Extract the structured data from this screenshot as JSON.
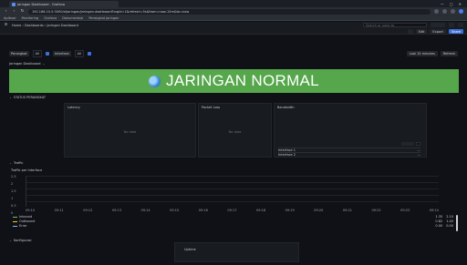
{
  "browser": {
    "tab_title": "Jaringan Dashboard - Grafana",
    "address": "192.168.10.5:3000/d/jaringan/jaringan-dashboard?orgId=1&refresh=5s&from=now-15m&to=now",
    "bookmarks": [
      "Aplikasi",
      "Monitoring",
      "Grafana",
      "Dokumentasi",
      "Perangkat Jaringan"
    ],
    "window_controls": [
      "—",
      "▢",
      "✕"
    ]
  },
  "grafana": {
    "breadcrumb": "Home › Dashboards › Jaringan Dashboard",
    "search_placeholder": "Search or jump to",
    "buttons": [
      "Edit",
      "Export",
      "Share"
    ]
  },
  "variables": [
    {
      "label": "Perangkat",
      "value": "All"
    },
    {
      "label": "Interface",
      "value": "All"
    }
  ],
  "var_right": [
    "Last 15 minutes",
    "Refresh"
  ],
  "section_dashboard": "Jaringan Dashboard",
  "banner": {
    "text": "JARINGAN NORMAL"
  },
  "row1": {
    "title": "STATUS PERANGKAT"
  },
  "panels": [
    {
      "title": "Latency",
      "nodata": "No data"
    },
    {
      "title": "Packet Loss",
      "nodata": "No data"
    },
    {
      "title": "Bandwidth"
    }
  ],
  "table": {
    "rows": [
      {
        "name": "Interface 1",
        "value": "—"
      },
      {
        "name": "Interface 2",
        "value": "—"
      }
    ]
  },
  "row2": {
    "title": "Traffic"
  },
  "timeseries": {
    "title": "Traffic per Interface",
    "y_ticks": [
      "2.5",
      "2",
      "1.5",
      "1",
      "0.5",
      "0"
    ],
    "x_ticks": [
      "09:10",
      "09:11",
      "09:12",
      "09:13",
      "09:14",
      "09:15",
      "09:16",
      "09:17",
      "09:18",
      "09:19",
      "09:20",
      "09:21",
      "09:22",
      "09:23",
      "09:24"
    ],
    "legend": [
      {
        "name": "Inbound",
        "mean": "1.35",
        "max": "2.10"
      },
      {
        "name": "Outbound",
        "mean": "0.82",
        "max": "1.40"
      },
      {
        "name": "Error",
        "mean": "0.00",
        "max": "0.00"
      }
    ]
  },
  "row3": {
    "title": "Konfigurasi"
  },
  "bottom_panel": {
    "title": "Uptime"
  }
}
